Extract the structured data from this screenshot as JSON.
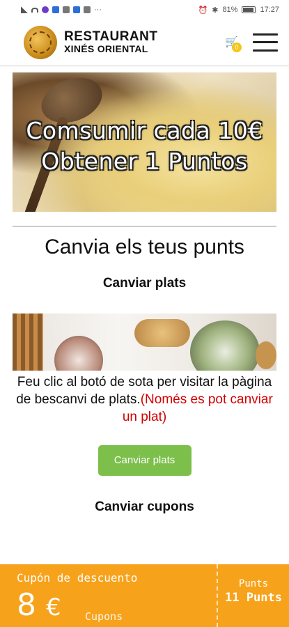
{
  "status_bar": {
    "battery": "81%",
    "time": "17:27",
    "dots": "···"
  },
  "header": {
    "brand_line1": "RESTAURANT",
    "brand_line2": "XINÉS ORIENTAL",
    "cart_count": "0"
  },
  "hero": {
    "line1": "Comsumir cada 10€",
    "line2": "Obtener 1 Puntos"
  },
  "main": {
    "title": "Canvia els teus punts",
    "dishes_title": "Canviar plats",
    "info_text": "Feu clic al botó de sota per visitar la pàgina de bescanvi de plats.",
    "info_warning": "(Només es pot canviar un plat)",
    "dishes_button": "Canviar plats",
    "coupons_title": "Canviar cupons"
  },
  "coupon": {
    "title": "Cupón de descuento",
    "amount": "8",
    "currency": "€",
    "subtitle": "Cupons",
    "side_label": "Punts",
    "side_value": "11 Punts"
  },
  "colors": {
    "button_green": "#7cbf4b",
    "coupon_orange": "#f7a21b",
    "warning_red": "#d30000",
    "badge_yellow": "#f5c518"
  }
}
